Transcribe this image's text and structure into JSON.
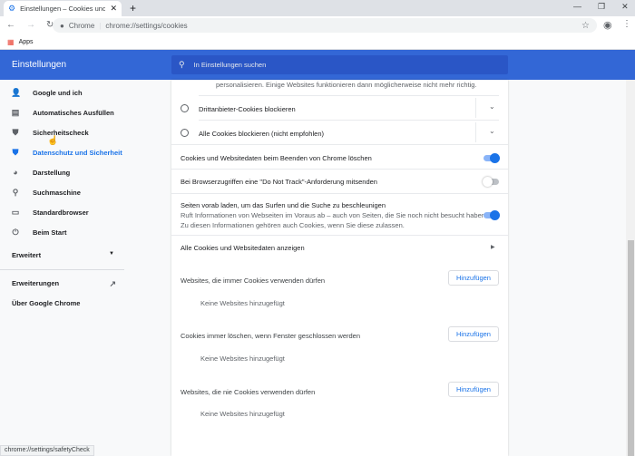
{
  "browser": {
    "tab_title": "Einstellungen – Cookies und and",
    "new_tab": "+",
    "omnibox_site": "Chrome",
    "omnibox_url": "chrome://settings/cookies",
    "bookmarks_apps": "Apps",
    "status_url": "chrome://settings/safetyCheck"
  },
  "header": {
    "title": "Einstellungen",
    "search_placeholder": "In Einstellungen suchen"
  },
  "sidebar": {
    "items": [
      {
        "label": "Google und ich",
        "icon": "person-icon"
      },
      {
        "label": "Automatisches Ausfüllen",
        "icon": "clipboard-icon"
      },
      {
        "label": "Sicherheitscheck",
        "icon": "shield-check-icon"
      },
      {
        "label": "Datenschutz und Sicherheit",
        "icon": "shield-icon",
        "selected": true
      },
      {
        "label": "Darstellung",
        "icon": "palette-icon"
      },
      {
        "label": "Suchmaschine",
        "icon": "search-icon"
      },
      {
        "label": "Standardbrowser",
        "icon": "browser-icon"
      },
      {
        "label": "Beim Start",
        "icon": "power-icon"
      }
    ],
    "advanced": "Erweitert",
    "extensions": "Erweiterungen",
    "about": "Über Google Chrome"
  },
  "main": {
    "top_text": "personalisieren. Einige Websites funktionieren dann möglicherweise nicht mehr richtig.",
    "radio1": "Drittanbieter-Cookies blockieren",
    "radio2": "Alle Cookies blockieren (nicht empfohlen)",
    "toggle1": {
      "label": "Cookies und Websitedaten beim Beenden von Chrome löschen",
      "on": true
    },
    "toggle2": {
      "label": "Bei Browserzugriffen eine \"Do Not Track\"-Anforderung mitsenden",
      "on": false
    },
    "toggle3": {
      "label": "Seiten vorab laden, um das Surfen und die Suche zu beschleunigen",
      "sub1": "Ruft Informationen von Webseiten im Voraus ab – auch von Seiten, die Sie noch nicht besucht haben.",
      "sub2": "Zu diesen Informationen gehören auch Cookies, wenn Sie diese zulassen.",
      "on": true
    },
    "all_cookies": "Alle Cookies und Websitedaten anzeigen",
    "sections": [
      {
        "title": "Websites, die immer Cookies verwenden dürfen",
        "button": "Hinzufügen",
        "empty": "Keine Websites hinzugefügt"
      },
      {
        "title": "Cookies immer löschen, wenn Fenster geschlossen werden",
        "button": "Hinzufügen",
        "empty": "Keine Websites hinzugefügt"
      },
      {
        "title": "Websites, die nie Cookies verwenden dürfen",
        "button": "Hinzufügen",
        "empty": "Keine Websites hinzugefügt"
      }
    ]
  },
  "colors": {
    "accent": "#1a73e8",
    "header": "#3367d6"
  }
}
